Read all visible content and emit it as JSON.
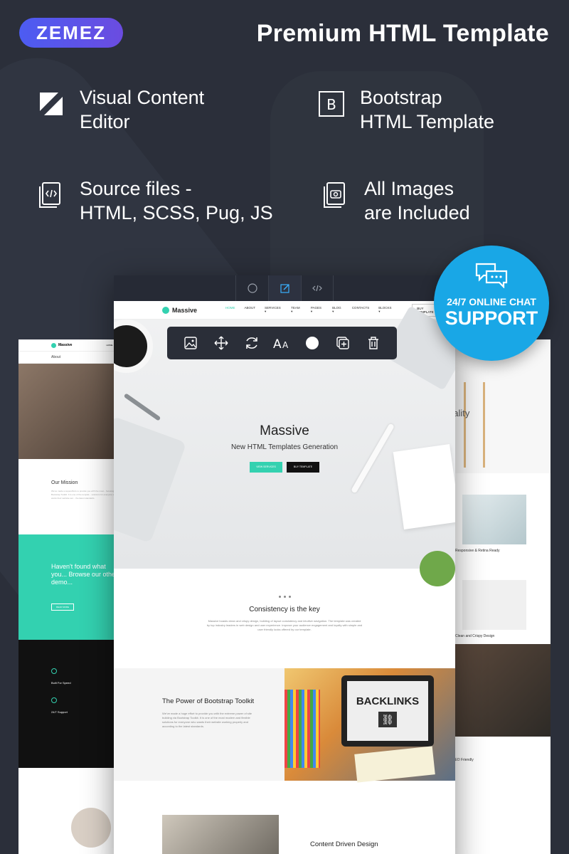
{
  "brand": {
    "logo": "ZEMEZ"
  },
  "headline": "Premium HTML Template",
  "features": [
    {
      "icon": "visual-editor-icon",
      "line1": "Visual Content",
      "line2": "Editor"
    },
    {
      "icon": "bootstrap-icon",
      "glyph": "B",
      "line1": "Bootstrap",
      "line2": "HTML Template"
    },
    {
      "icon": "source-files-icon",
      "line1": "Source files -",
      "line2": "HTML, SCSS, Pug, JS"
    },
    {
      "icon": "images-icon",
      "line1": "All Images",
      "line2": "are Included"
    }
  ],
  "support": {
    "line1": "24/7 ONLINE CHAT",
    "line2": "SUPPORT",
    "color": "#19a7e6"
  },
  "mockup": {
    "site_name": "Massive",
    "nav": [
      "HOME",
      "ABOUT",
      "SERVICES ▾",
      "TEAM ▾",
      "PAGES ▾",
      "BLOG ▾",
      "CONTACTS",
      "BLOCKS ▾"
    ],
    "nav_button": "BUY TEMPLATE",
    "hero": {
      "title": "Massive",
      "subtitle": "New HTML Templates Generation",
      "btn1": "VIEW SERVICES",
      "btn2": "BUY TEMPLATE"
    },
    "key": {
      "title": "Consistency is the key",
      "text": "Massive boasts clean and crispy design, building of layout consistency and intuitive navigation. The template was created by top industry leaders in web design and user experience. Improve your audience engagement and loyalty with simple and user friendly looks offered by our template."
    },
    "bootstrap": {
      "title": "The Power of Bootstrap Toolkit",
      "text": "We've made a huge effort to provide you with the extreme power of site building via Bootstrap Toolkit. It is one of the most modern and flexible solutions for everyone who wants their website working properly and according to the latest standards."
    },
    "backlinks": "BACKLINKS",
    "content_title": "Content Driven Design"
  },
  "left_mockup": {
    "site_name": "Massive",
    "nav_home": "HOME",
    "breadcrumb": "About",
    "mission_title": "Our Mission",
    "mission_text": "We've made a superefforts to provide you with the most... focusing via Bootstrap Toolkit. It is one of the templat... solutions for everyone who wants their website wor... the latest standards.",
    "teal_title": "Haven't found what you... Browse our other demo...",
    "teal_btn": "READ MORE",
    "speed": "Built For Speed",
    "support": "24/7 Support"
  },
  "right_mockup": {
    "quality": "uality",
    "item1": "Responsive & Retina Ready",
    "item2": "Clean and Crispy Design",
    "item3": "SEO Friendly"
  }
}
